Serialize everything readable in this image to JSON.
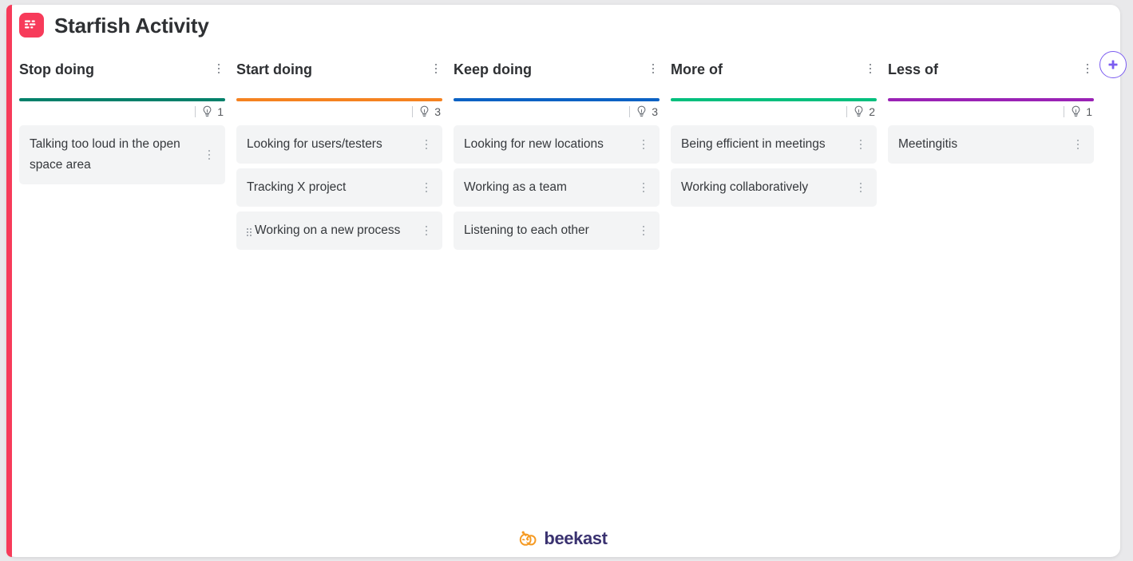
{
  "header": {
    "title": "Starfish Activity",
    "logo_icon": "beekast-app-icon",
    "logo_color": "#f73b5a"
  },
  "toolbar": {
    "add_column_label": "+",
    "add_column_icon": "plus-icon",
    "add_column_color": "#7b5cf0"
  },
  "board": {
    "columns": [
      {
        "title": "Stop doing",
        "color": "#00806a",
        "idea_count": "1",
        "menu_icon": "kebab-menu-icon",
        "count_icon": "lightbulb-icon",
        "cards": [
          {
            "text": "Talking too loud in the open space area",
            "has_drag_handle": false
          }
        ]
      },
      {
        "title": "Start doing",
        "color": "#f58220",
        "idea_count": "3",
        "menu_icon": "kebab-menu-icon",
        "count_icon": "lightbulb-icon",
        "cards": [
          {
            "text": "Looking for users/testers",
            "has_drag_handle": false
          },
          {
            "text": "Tracking X project",
            "has_drag_handle": false
          },
          {
            "text": "Working on a new process",
            "has_drag_handle": true
          }
        ]
      },
      {
        "title": "Keep doing",
        "color": "#0b62c4",
        "idea_count": "3",
        "menu_icon": "kebab-menu-icon",
        "count_icon": "lightbulb-icon",
        "cards": [
          {
            "text": "Looking for new locations",
            "has_drag_handle": false
          },
          {
            "text": "Working as a team",
            "has_drag_handle": false
          },
          {
            "text": "Listening to each other",
            "has_drag_handle": false
          }
        ]
      },
      {
        "title": "More of",
        "color": "#00bf7d",
        "idea_count": "2",
        "menu_icon": "kebab-menu-icon",
        "count_icon": "lightbulb-icon",
        "cards": [
          {
            "text": "Being efficient in meetings",
            "has_drag_handle": false
          },
          {
            "text": "Working collaboratively",
            "has_drag_handle": false
          }
        ]
      },
      {
        "title": "Less of",
        "color": "#9a22b5",
        "idea_count": "1",
        "menu_icon": "kebab-menu-icon",
        "count_icon": "lightbulb-icon",
        "cards": [
          {
            "text": "Meetingitis",
            "has_drag_handle": false
          }
        ]
      }
    ]
  },
  "footer": {
    "brand_name": "beekast",
    "brand_icon": "beekast-bee-icon",
    "brand_icon_color": "#f59a23",
    "brand_text_color": "#3a3270"
  }
}
